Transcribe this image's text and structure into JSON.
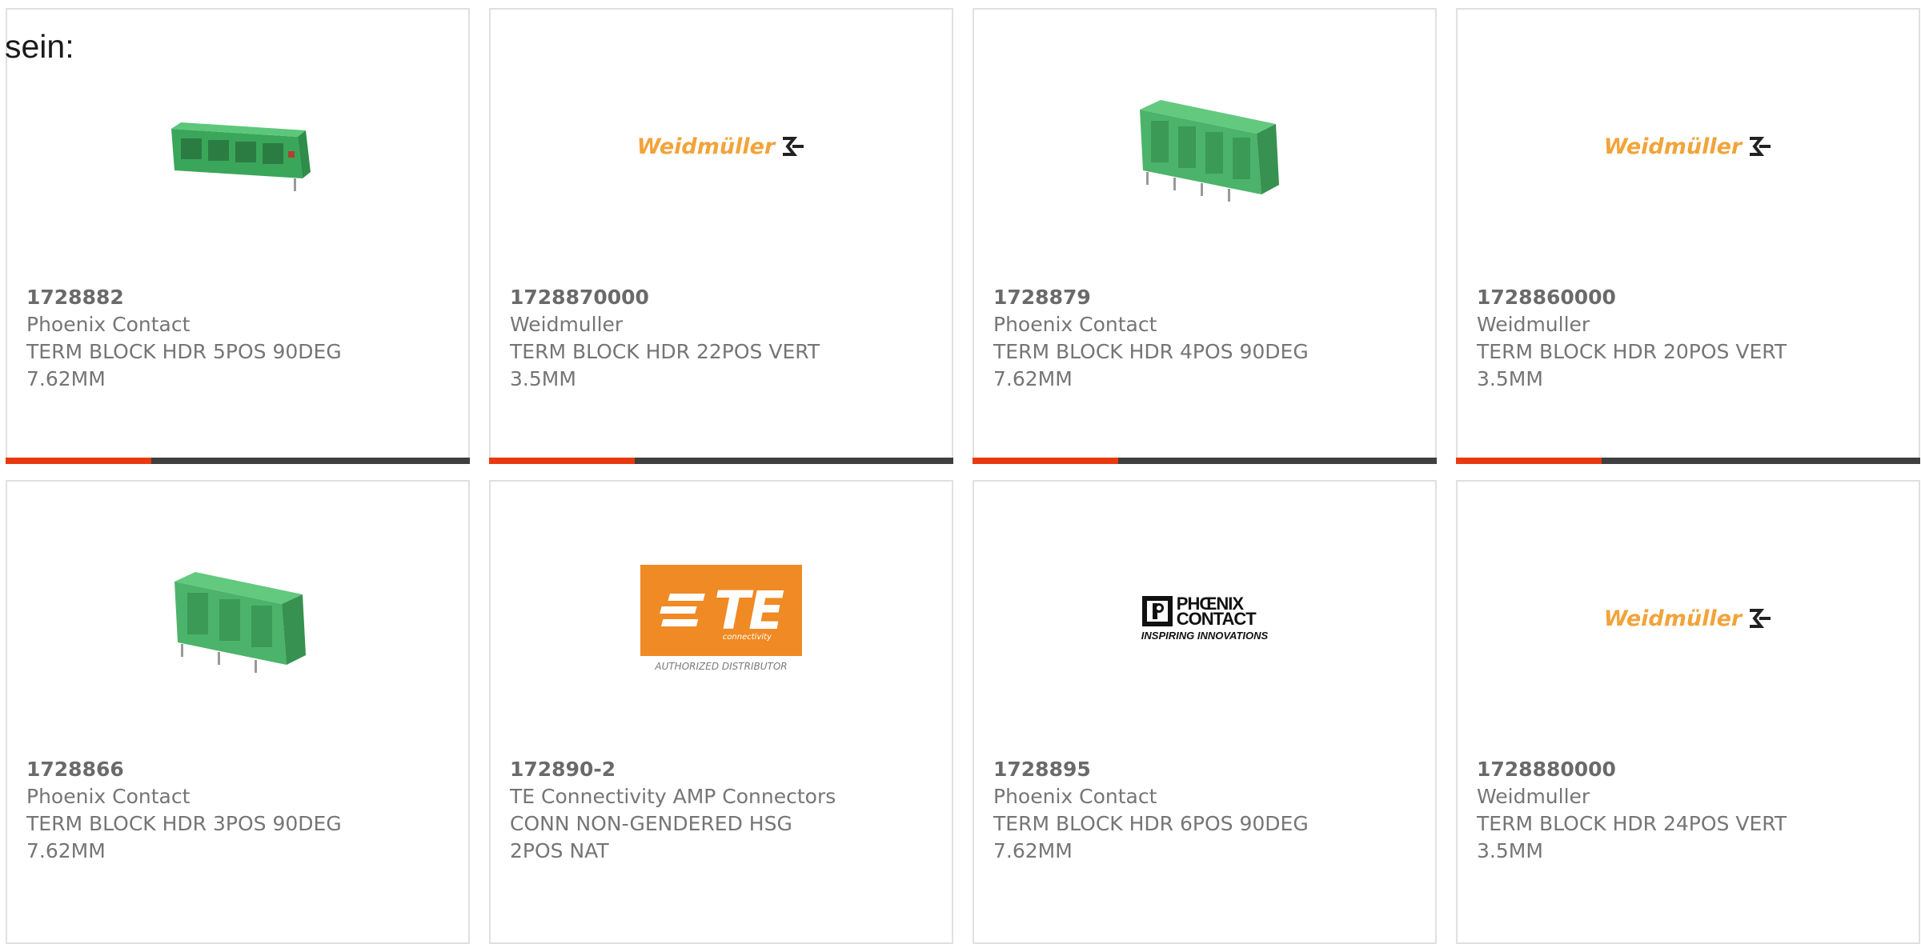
{
  "intro_text": "sein:",
  "accent_color": "#e83a10",
  "products": [
    {
      "part_number": "1728882",
      "manufacturer": "Phoenix Contact",
      "description_line1": "TERM BLOCK HDR 5POS 90DEG",
      "description_line2": "7.62MM",
      "image": "green-terminal-block-5pos-angled"
    },
    {
      "part_number": "1728870000",
      "manufacturer": "Weidmuller",
      "description_line1": "TERM BLOCK HDR 22POS VERT",
      "description_line2": "3.5MM",
      "image": "weidmuller-logo",
      "logo_text": "Weidmüller"
    },
    {
      "part_number": "1728879",
      "manufacturer": "Phoenix Contact",
      "description_line1": "TERM BLOCK HDR 4POS 90DEG",
      "description_line2": "7.62MM",
      "image": "green-terminal-block-4pos"
    },
    {
      "part_number": "1728860000",
      "manufacturer": "Weidmuller",
      "description_line1": "TERM BLOCK HDR 20POS VERT",
      "description_line2": "3.5MM",
      "image": "weidmuller-logo",
      "logo_text": "Weidmüller"
    },
    {
      "part_number": "1728866",
      "manufacturer": "Phoenix Contact",
      "description_line1": "TERM BLOCK HDR 3POS 90DEG",
      "description_line2": "7.62MM",
      "image": "green-terminal-block-3pos"
    },
    {
      "part_number": "172890-2",
      "manufacturer": "TE Connectivity AMP Connectors",
      "description_line1": "CONN NON-GENDERED HSG",
      "description_line2": "2POS NAT",
      "image": "te-connectivity-logo",
      "logo_text": "TE",
      "logo_subtext": "connectivity",
      "logo_caption": "AUTHORIZED DISTRIBUTOR"
    },
    {
      "part_number": "1728895",
      "manufacturer": "Phoenix Contact",
      "description_line1": "TERM BLOCK HDR 6POS 90DEG",
      "description_line2": "7.62MM",
      "image": "phoenix-contact-logo",
      "logo_text_1": "PHŒNIX",
      "logo_text_2": "CONTACT",
      "logo_caption": "INSPIRING INNOVATIONS"
    },
    {
      "part_number": "1728880000",
      "manufacturer": "Weidmuller",
      "description_line1": "TERM BLOCK HDR 24POS VERT",
      "description_line2": "3.5MM",
      "image": "weidmuller-logo",
      "logo_text": "Weidmüller"
    }
  ]
}
